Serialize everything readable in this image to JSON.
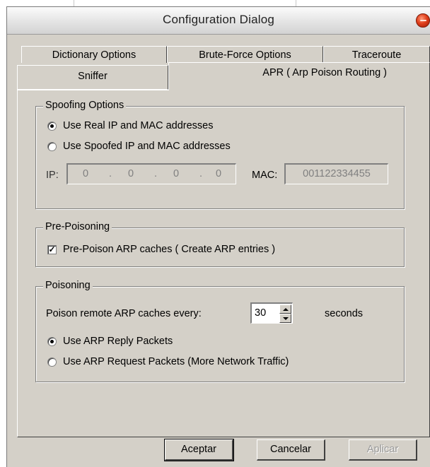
{
  "window": {
    "title": "Configuration Dialog"
  },
  "tabs": {
    "row1": [
      "Dictionary Options",
      "Brute-Force Options",
      "Traceroute"
    ],
    "row2": [
      "Sniffer",
      "APR ( Arp Poison Routing )"
    ]
  },
  "spoofing": {
    "legend": "Spoofing Options",
    "opt_real": "Use Real IP and MAC addresses",
    "opt_spoofed": "Use Spoofed IP and MAC addresses",
    "selected": "real",
    "ip_label": "IP:",
    "ip_octets": [
      "0",
      "0",
      "0",
      "0"
    ],
    "mac_label": "MAC:",
    "mac_value": "001122334455"
  },
  "prepoison": {
    "legend": "Pre-Poisoning",
    "checkbox_label": "Pre-Poison ARP caches ( Create ARP entries )",
    "checked": true
  },
  "poisoning": {
    "legend": "Poisoning",
    "interval_label": "Poison remote ARP caches every:",
    "interval_value": "30",
    "interval_unit": "seconds",
    "opt_reply": "Use ARP Reply Packets",
    "opt_request": "Use ARP Request Packets (More Network Traffic)",
    "selected": "reply"
  },
  "buttons": {
    "ok": "Aceptar",
    "cancel": "Cancelar",
    "apply": "Aplicar"
  }
}
